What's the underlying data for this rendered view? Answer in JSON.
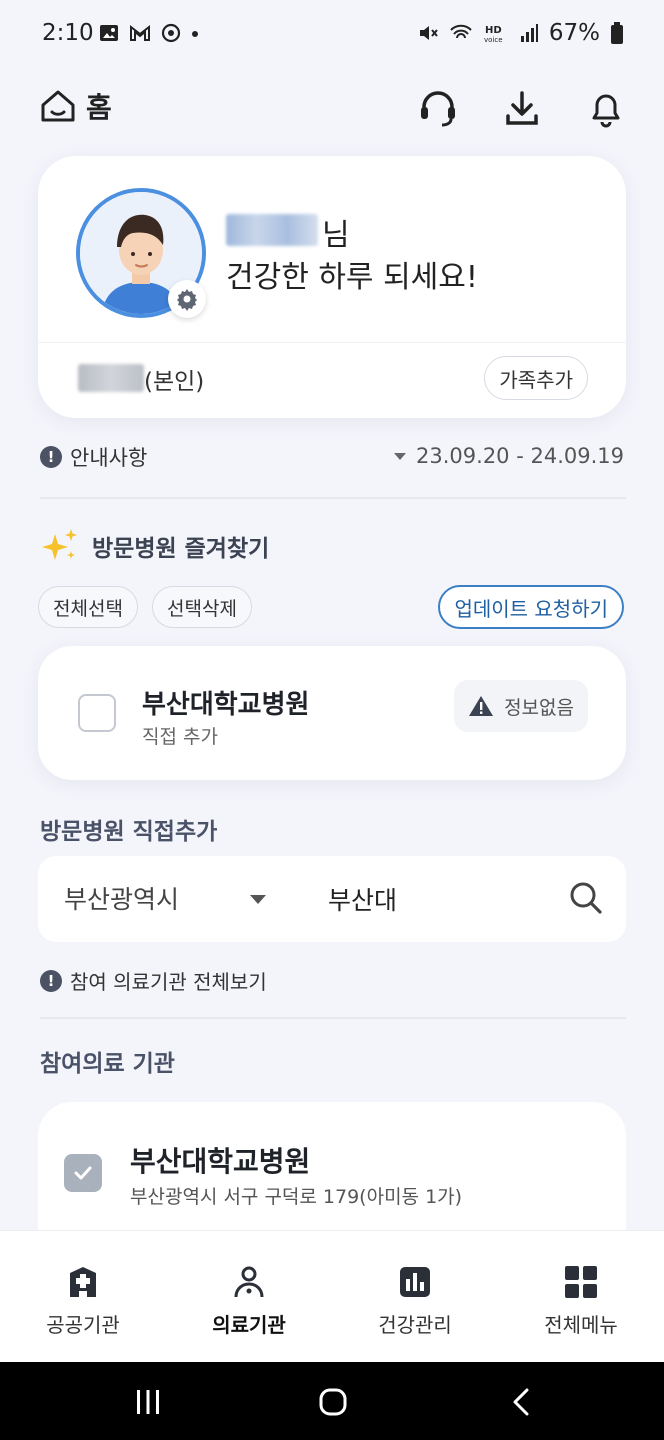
{
  "status_bar": {
    "time": "2:10",
    "battery": "67%",
    "icons": [
      "image-icon",
      "gmail-icon",
      "sync-icon",
      "dot-icon",
      "mute-icon",
      "wifi-icon",
      "hd-voice-icon",
      "signal-icon",
      "battery-icon"
    ]
  },
  "header": {
    "home_label": "홈",
    "icons": [
      "headset-icon",
      "download-icon",
      "bell-icon"
    ]
  },
  "profile": {
    "name_suffix": "님",
    "greeting": "건강한 하루 되세요!",
    "self_label": "(본인)",
    "add_family": "가족추가"
  },
  "notice": {
    "label": "안내사항",
    "date_range": "23.09.20 - 24.09.19"
  },
  "favorites": {
    "title": "방문병원 즐겨찾기",
    "select_all": "전체선택",
    "delete_selected": "선택삭제",
    "request_update": "업데이트 요청하기",
    "items": [
      {
        "name": "부산대학교병원",
        "sub": "직접 추가",
        "status": "정보없음"
      }
    ]
  },
  "direct_add": {
    "title": "방문병원 직접추가",
    "region": "부산광역시",
    "query": "부산대"
  },
  "participating": {
    "link": "참여 의료기관 전체보기",
    "title": "참여의료 기관",
    "items": [
      {
        "name": "부산대학교병원",
        "address": "부산광역시 서구 구덕로 179(아미동 1가)"
      }
    ]
  },
  "bottom_nav": [
    {
      "label": "공공기관",
      "icon": "public-institution-icon",
      "active": false
    },
    {
      "label": "의료기관",
      "icon": "medical-institution-icon",
      "active": true
    },
    {
      "label": "건강관리",
      "icon": "health-chart-icon",
      "active": false
    },
    {
      "label": "전체메뉴",
      "icon": "grid-menu-icon",
      "active": false
    }
  ],
  "colors": {
    "background": "#f4f5fb",
    "accent_blue": "#3c7fc4",
    "avatar_ring": "#4a8fe0"
  }
}
